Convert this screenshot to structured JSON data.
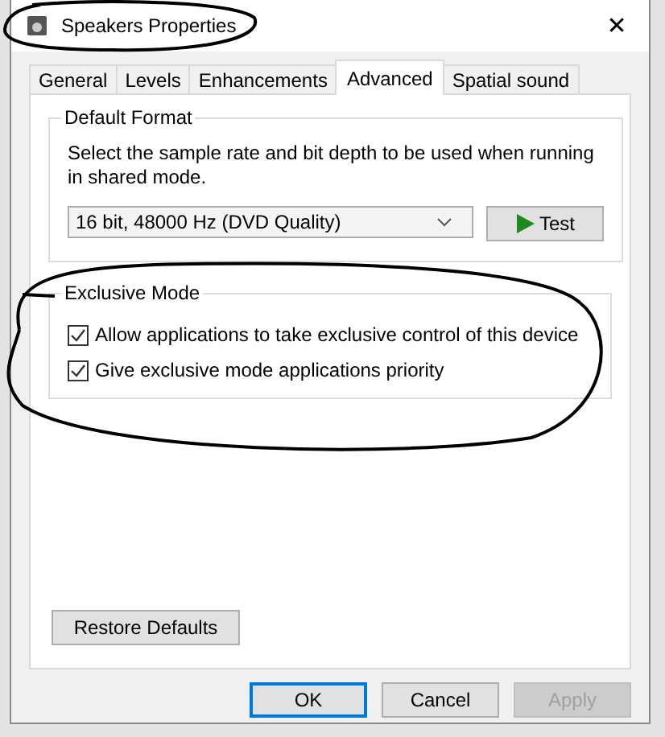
{
  "window": {
    "title": "Speakers Properties",
    "close": "✕"
  },
  "tabs": [
    {
      "label": "General",
      "selected": false
    },
    {
      "label": "Levels",
      "selected": false
    },
    {
      "label": "Enhancements",
      "selected": false
    },
    {
      "label": "Advanced",
      "selected": true
    },
    {
      "label": "Spatial sound",
      "selected": false
    }
  ],
  "default_format": {
    "title": "Default Format",
    "description": "Select the sample rate and bit depth to be used when running in shared mode.",
    "dropdown": {
      "value": "16 bit, 48000 Hz (DVD Quality)"
    },
    "test_button": "Test"
  },
  "exclusive_mode": {
    "title": "Exclusive Mode",
    "options": [
      {
        "label": "Allow applications to take exclusive control of this device",
        "checked": true
      },
      {
        "label": "Give exclusive mode applications priority",
        "checked": true
      }
    ]
  },
  "restore_defaults": "Restore Defaults",
  "buttons": [
    {
      "label": "OK",
      "default": true,
      "disabled": false
    },
    {
      "label": "Cancel",
      "default": false,
      "disabled": false
    },
    {
      "label": "Apply",
      "default": false,
      "disabled": true
    }
  ]
}
